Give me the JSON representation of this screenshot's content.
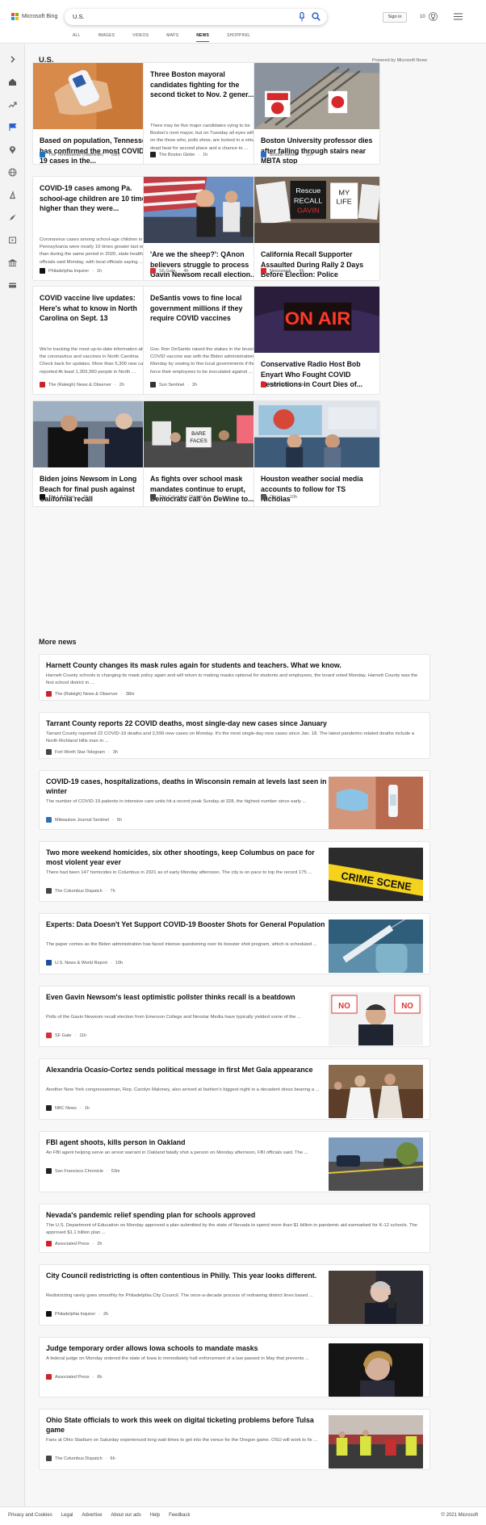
{
  "header": {
    "brand": "Microsoft Bing",
    "search_value": "U.S.",
    "signin_label": "Sign in",
    "rewards_count": "10",
    "nav": [
      {
        "label": "ALL",
        "active": false
      },
      {
        "label": "IMAGES",
        "active": false
      },
      {
        "label": "VIDEOS",
        "active": false
      },
      {
        "label": "MAPS",
        "active": false
      },
      {
        "label": "NEWS",
        "active": true
      },
      {
        "label": "SHOPPING",
        "active": false
      }
    ]
  },
  "section": {
    "title": "U.S.",
    "powered_by": "Powered by Microsoft News"
  },
  "cards": [
    {
      "title": "Based on population, Tennessee has confirmed the most COVID-19 cases in the...",
      "snippet": "",
      "source": "The Tennessean (Nashville)",
      "time": "59m",
      "image": "thermometer",
      "favicon_color": "#1b74c5"
    },
    {
      "title": "Three Boston mayoral candidates fighting for the second ticket to Nov. 2 gener...",
      "snippet": "There may be five major candidates vying to be Boston's next mayor, but on Tuesday all eyes will be on the three who, polls show, are locked in a virtual dead heat for second place and a chance to ...",
      "source": "The Boston Globe",
      "time": "1h",
      "image": "none",
      "favicon_color": "#222222"
    },
    {
      "title": "Boston University professor dies after falling through stairs near MBTA stop",
      "snippet": "",
      "source": "Boston Herald",
      "time": "10h",
      "image": "stairs",
      "favicon_color": "#2b6cc4"
    },
    {
      "title": "COVID-19 cases among Pa. school-age children are 10 times higher than they were...",
      "snippet": "Coronavirus cases among school-age children in Pennsylvania were nearly 10 times greater last week than during the same period in 2020, state health officials said Monday, with local officials saying ...",
      "source": "Philadelphia Inquirer",
      "time": "1h",
      "image": "none",
      "favicon_color": "#111111"
    },
    {
      "title": "'Are we the sheep?': QAnon believers struggle to process Gavin Newsom recall election...",
      "snippet": "",
      "source": "SF Gate",
      "time": "4h",
      "image": "rally",
      "favicon_color": "#d3313a"
    },
    {
      "title": "California Recall Supporter Assaulted During Rally 2 Days Before Election: Police",
      "snippet": "",
      "source": "Newsweek",
      "time": "4h",
      "image": "signs",
      "favicon_color": "#d8262d"
    },
    {
      "title": "COVID vaccine live updates: Here's what to know in North Carolina on Sept. 13",
      "snippet": "We're tracking the most up-to-date information about the coronavirus and vaccines in North Carolina. Check back for updates. More than 5,300 new cases reported At least 1,303,390 people in North ...",
      "source": "The (Raleigh) News & Observer",
      "time": "2h",
      "image": "none",
      "favicon_color": "#c8242b"
    },
    {
      "title": "DeSantis vows to fine local government millions if they require COVID vaccines",
      "snippet": "Gov. Ron DeSantis raised the stakes in the bruising COVID vaccine war with the Biden administration Monday by vowing to fine local governments if they force their employees to be inoculated against ...",
      "source": "Sun Sentinel",
      "time": "2h",
      "image": "none",
      "favicon_color": "#333333"
    },
    {
      "title": "Conservative Radio Host Bob Enyart Who Fought COVID Restrictions in Court Dies of...",
      "snippet": "",
      "source": "Newsweek",
      "time": "1h",
      "image": "onair",
      "favicon_color": "#d8262d"
    },
    {
      "title": "Biden joins Newsom in Long Beach for final push against California recall",
      "snippet": "",
      "source": "The LA Times",
      "time": "6h",
      "image": "biden",
      "favicon_color": "#111111"
    },
    {
      "title": "As fights over school mask mandates continue to erupt, Democrats call on DeWine to...",
      "snippet": "",
      "source": "The Columbus Dispatch",
      "time": "4h",
      "image": "masks",
      "favicon_color": "#444444"
    },
    {
      "title": "Houston weather social media accounts to follow for TS Nicholas",
      "snippet": "",
      "source": "Chron",
      "time": "10h",
      "image": "weather",
      "favicon_color": "#555555"
    }
  ],
  "more_news": {
    "title": "More news",
    "items": [
      {
        "title": "Harnett County changes its mask rules again for students and teachers. What we know.",
        "snippet": "Harnett County schools is changing its mask policy again and will return to making masks optional for students and employees, the board voted Monday. Harnett County was the first school district in ...",
        "source": "The (Raleigh) News & Observer",
        "time": "38m",
        "image": "none",
        "favicon_color": "#c8242b"
      },
      {
        "title": "Tarrant County reports 22 COVID deaths, most single-day new cases since January",
        "snippet": "Tarrant County reported 22 COVID-19 deaths and 2,599 new cases on Monday. It's the most single-day new cases since Jan. 18. The latest pandemic-related deaths include a North Richland Hills man in ...",
        "source": "Fort Worth Star-Telegram",
        "time": "3h",
        "image": "none",
        "favicon_color": "#444444"
      },
      {
        "title": "COVID-19 cases, hospitalizations, deaths in Wisconsin remain at levels last seen in winter",
        "snippet": "The number of COVID-19 patients in intensive care units hit a recent peak Sunday at 328, the highest number since early ...",
        "source": "Milwaukee Journal Sentinel",
        "time": "5h",
        "image": "vaccine",
        "favicon_color": "#2d6fb8"
      },
      {
        "title": "Two more weekend homicides, six other shootings, keep Columbus on pace for most violent year ever",
        "snippet": "There had been 147 homicides in Columbus in 2021 as of early Monday afternoon. The city is on pace to top the record 175 ...",
        "source": "The Columbus Dispatch",
        "time": "7h",
        "image": "crimetape",
        "favicon_color": "#444444"
      },
      {
        "title": "Experts: Data Doesn't Yet Support COVID-19 Booster Shots for General Population",
        "snippet": "The paper comes as the Biden administration has faced intense questioning over its booster shot program, which is scheduled ...",
        "source": "U.S. News & World Report",
        "time": "10h",
        "image": "syringe",
        "favicon_color": "#1e4f9a"
      },
      {
        "title": "Even Gavin Newsom's least optimistic pollster thinks recall is a beatdown",
        "snippet": "Polls of the Gavin Newsom recall election from Emerson College and Nexstar Media have typically yielded some of the ...",
        "source": "SF Gate",
        "time": "11h",
        "image": "newsom",
        "favicon_color": "#d3313a"
      },
      {
        "title": "Alexandria Ocasio-Cortez sends political message in first Met Gala appearance",
        "snippet": "Another New York congresswoman, Rep. Carolyn Maloney, also arrived at fashion's biggest night in a decadent dress bearing a ...",
        "source": "NBC News",
        "time": "1h",
        "image": "gala",
        "favicon_color": "#222222"
      },
      {
        "title": "FBI agent shoots, kills person in Oakland",
        "snippet": "An FBI agent helping serve an arrest warrant in Oakland fatally shot a person on Monday afternoon, FBI officials said. The ...",
        "source": "San Francisco Chronicle",
        "time": "53m",
        "image": "street",
        "favicon_color": "#222222"
      },
      {
        "title": "Nevada's pandemic relief spending plan for schools approved",
        "snippet": "The U.S. Department of Education on Monday approved a plan submitted by the state of Nevada to spend more than $1 billion in pandemic aid earmarked for K-12 schools. The approved $1.1 billion plan ...",
        "source": "Associated Press",
        "time": "2h",
        "image": "none",
        "favicon_color": "#d3212a"
      },
      {
        "title": "City Council redistricting is often contentious in Philly. This year looks different.",
        "snippet": "Redistricting rarely goes smoothly for Philadelphia City Council. The once-a-decade process of redrawing district lines based ...",
        "source": "Philadelphia Inquirer",
        "time": "2h",
        "image": "council",
        "favicon_color": "#111111"
      },
      {
        "title": "Judge temporary order allows Iowa schools to mandate masks",
        "snippet": "A federal judge on Monday ordered the state of Iowa to immediately halt enforcement of a law passed in May that prevents ...",
        "source": "Associated Press",
        "time": "6h",
        "image": "iowa",
        "favicon_color": "#d3212a"
      },
      {
        "title": "Ohio State officials to work this week on digital ticketing problems before Tulsa game",
        "snippet": "Fans at Ohio Stadium on Saturday experienced long wait times to get into the venue for the Oregon game. OSU will work to fix ...",
        "source": "The Columbus Dispatch",
        "time": "6h",
        "image": "stadium",
        "favicon_color": "#444444"
      }
    ]
  },
  "footer": {
    "links": [
      "Privacy and Cookies",
      "Legal",
      "Advertise",
      "About our ads",
      "Help",
      "Feedback"
    ],
    "copyright": "© 2021 Microsoft"
  }
}
